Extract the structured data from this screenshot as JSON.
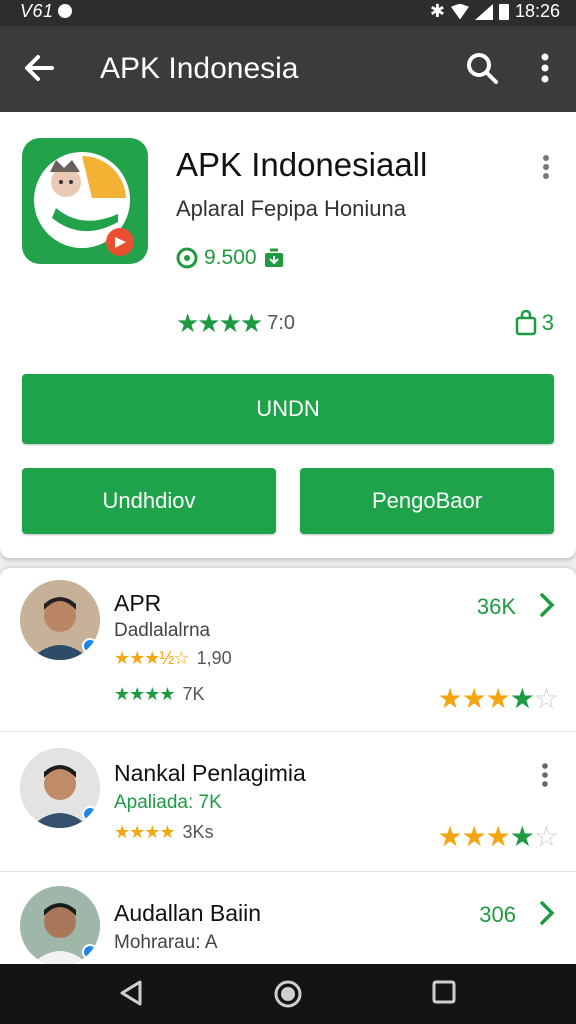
{
  "status_bar": {
    "left_text": "V61",
    "time": "18:26"
  },
  "app_bar": {
    "title": "APK Indonesia"
  },
  "app": {
    "title": "APK Indonesiaall",
    "subtitle": "Aplaral Fepipa Honiuna",
    "price": "9.500",
    "rating_value": "7:0",
    "downloads": "3",
    "install_label": "UNDN",
    "left_button_label": "Undhdiov",
    "right_button_label": "PengoBaor"
  },
  "list": [
    {
      "name": "APR",
      "subtitle": "Dadlalalrna",
      "stars_small_1": "★★★½☆",
      "count_1": "1,90",
      "stars_small_2": "★★★★",
      "count_2": "7K",
      "right_count": "36K",
      "trailing": "chevron",
      "big_stars": {
        "yellow": 3,
        "green": 1,
        "empty": 1
      }
    },
    {
      "name": "Nankal Penlagimia",
      "subtitle": "Apaliada: 7K",
      "stars_small_1": "★★★★",
      "count_1": "3Ks",
      "trailing": "more",
      "big_stars": {
        "yellow": 3,
        "green": 1,
        "empty": 1
      }
    },
    {
      "name": "Audallan Baiin",
      "subtitle": "Mohrarau: A",
      "right_count": "306",
      "trailing": "chevron"
    }
  ],
  "icons": {
    "back": "arrow-left-icon",
    "search": "search-icon",
    "more": "more-vert-icon",
    "chevron": "chevron-right-icon",
    "nav_back": "triangle-back-icon",
    "nav_home": "circle-home-icon",
    "nav_recents": "square-recents-icon"
  },
  "colors": {
    "accent": "#1fa34a",
    "appbar": "#3b3b3e",
    "star_yellow": "#f2a60f"
  }
}
